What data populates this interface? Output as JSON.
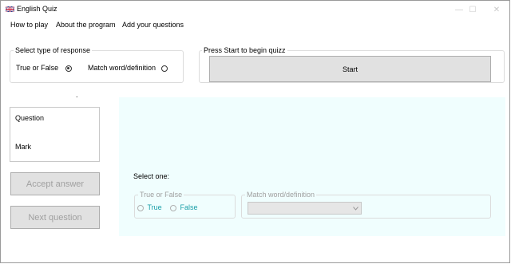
{
  "window": {
    "title": "English Quiz",
    "minimize_glyph": "—",
    "maximize_glyph": "☐",
    "close_glyph": "✕"
  },
  "menu": {
    "items": [
      "How to play",
      "About the program",
      "Add your questions"
    ]
  },
  "response_type": {
    "legend": "Select type of response",
    "option_true_false": "True or False",
    "option_match": "Match word/definition",
    "selected": "True or False"
  },
  "start_group": {
    "legend": "Press Start to begin quizz",
    "button": "Start"
  },
  "dot_label": ".",
  "question_box": {
    "question": "Question",
    "mark": "Mark"
  },
  "buttons": {
    "accept": "Accept answer",
    "next": "Next question"
  },
  "answer_panel": {
    "prompt": "Select one:",
    "tf_group": {
      "legend": "True or False",
      "true_label": "True",
      "false_label": "False"
    },
    "match_group": {
      "legend": "Match word/definition",
      "dropdown_value": ""
    }
  },
  "colors": {
    "panel_bg": "#f0fefe",
    "button_bg": "#e1e1e1",
    "teal_text": "#1a9fa8"
  },
  "icons": {
    "app": "uk-flag-icon",
    "dropdown": "chevron-down-icon"
  }
}
